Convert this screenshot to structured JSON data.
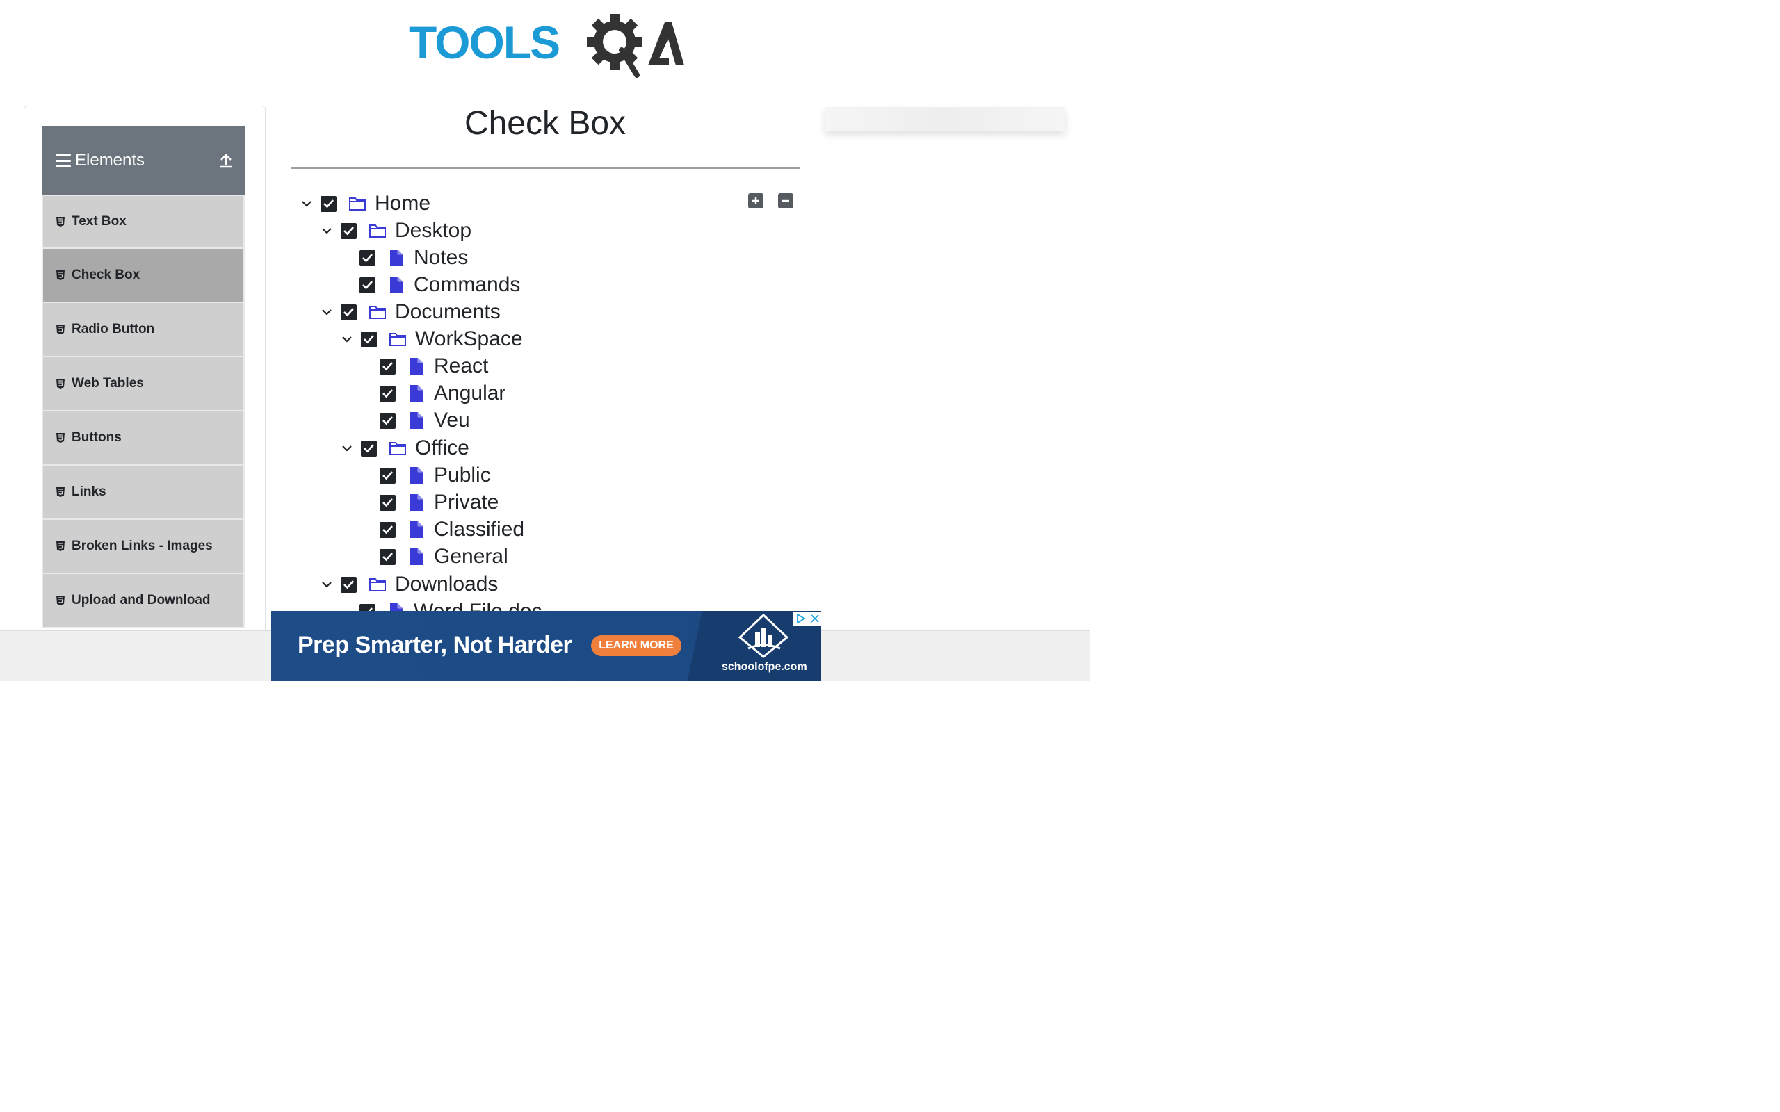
{
  "logo": {
    "text_part1": "TOOLS",
    "text_part2": "QA",
    "colors": {
      "blue": "#1c9ad6",
      "dark": "#333333"
    }
  },
  "sidebar": {
    "group_title": "Elements",
    "items": [
      {
        "label": "Text Box",
        "active": false
      },
      {
        "label": "Check Box",
        "active": true
      },
      {
        "label": "Radio Button",
        "active": false
      },
      {
        "label": "Web Tables",
        "active": false
      },
      {
        "label": "Buttons",
        "active": false
      },
      {
        "label": "Links",
        "active": false
      },
      {
        "label": "Broken Links - Images",
        "active": false
      },
      {
        "label": "Upload and Download",
        "active": false
      }
    ]
  },
  "main": {
    "title": "Check Box"
  },
  "tree": {
    "expand_all_icon": "plus-square-icon",
    "collapse_all_icon": "minus-square-icon",
    "nodes": [
      {
        "label": "Home",
        "type": "folder",
        "expanded": true,
        "checked": true
      },
      {
        "label": "Desktop",
        "type": "folder",
        "expanded": true,
        "checked": true
      },
      {
        "label": "Notes",
        "type": "file",
        "checked": true
      },
      {
        "label": "Commands",
        "type": "file",
        "checked": true
      },
      {
        "label": "Documents",
        "type": "folder",
        "expanded": true,
        "checked": true
      },
      {
        "label": "WorkSpace",
        "type": "folder",
        "expanded": true,
        "checked": true
      },
      {
        "label": "React",
        "type": "file",
        "checked": true
      },
      {
        "label": "Angular",
        "type": "file",
        "checked": true
      },
      {
        "label": "Veu",
        "type": "file",
        "checked": true
      },
      {
        "label": "Office",
        "type": "folder",
        "expanded": true,
        "checked": true
      },
      {
        "label": "Public",
        "type": "file",
        "checked": true
      },
      {
        "label": "Private",
        "type": "file",
        "checked": true
      },
      {
        "label": "Classified",
        "type": "file",
        "checked": true
      },
      {
        "label": "General",
        "type": "file",
        "checked": true
      },
      {
        "label": "Downloads",
        "type": "folder",
        "expanded": true,
        "checked": true
      },
      {
        "label": "Word File.doc",
        "type": "file",
        "checked": true
      }
    ]
  },
  "ad": {
    "headline": "Prep Smarter, Not Harder",
    "cta": "LEARN MORE",
    "brand": "schoolofpe.com",
    "colors": {
      "bg": "#1e4c86",
      "cta": "#f07f3c"
    }
  },
  "colors": {
    "icon_blue": "#3a3ad6",
    "checkbox": "#212529",
    "menu_bg": "#cfcfcf",
    "menu_active": "#a9a9a9",
    "header_bg": "#6c757d"
  }
}
